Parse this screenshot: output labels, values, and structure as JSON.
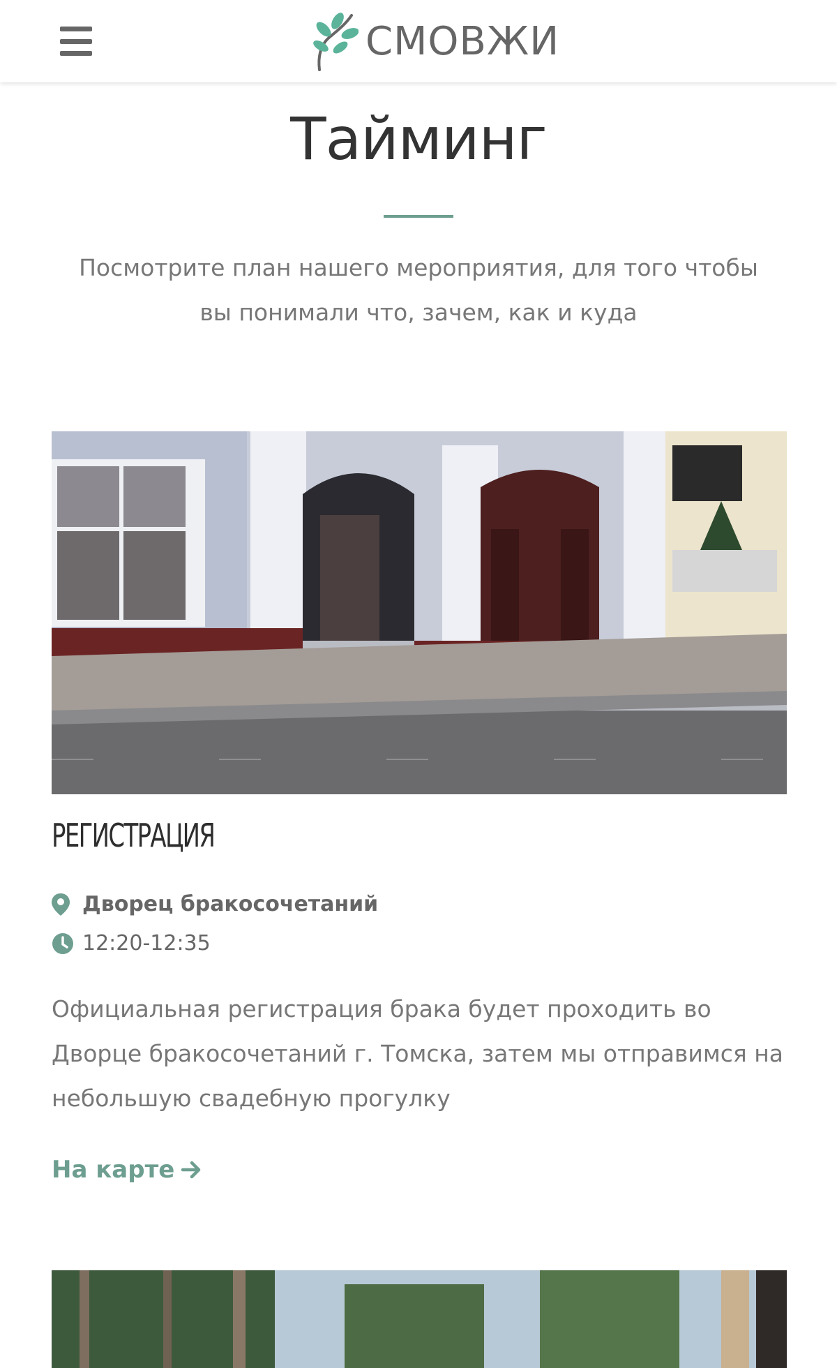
{
  "header": {
    "logo_text": "СМОВЖИ",
    "menu_icon": "hamburger-menu-icon",
    "logo_icon": "leaf-branch-icon"
  },
  "section": {
    "title": "Тайминг",
    "subtitle": "Посмотрите план нашего мероприятия, для того чтобы вы понимали что, зачем, как и куда"
  },
  "events": [
    {
      "image_icon": "building-photo",
      "title": "РЕГИСТРАЦИЯ",
      "place_icon": "map-pin-icon",
      "place": "Дворец бракосочетаний",
      "time_icon": "clock-icon",
      "time": "12:20-12:35",
      "description": "Официальная регистрация брака будет проходить во Дворце бракосочетаний г. Томска, затем мы отправимся на небольшую свадебную прогулку",
      "link_label": "На карте",
      "link_icon": "arrow-right-icon"
    },
    {
      "image_icon": "forest-photo"
    }
  ],
  "colors": {
    "accent": "#6d9e90",
    "heading": "#333333",
    "body_text": "#777777",
    "leaf": "#5bb39a"
  }
}
